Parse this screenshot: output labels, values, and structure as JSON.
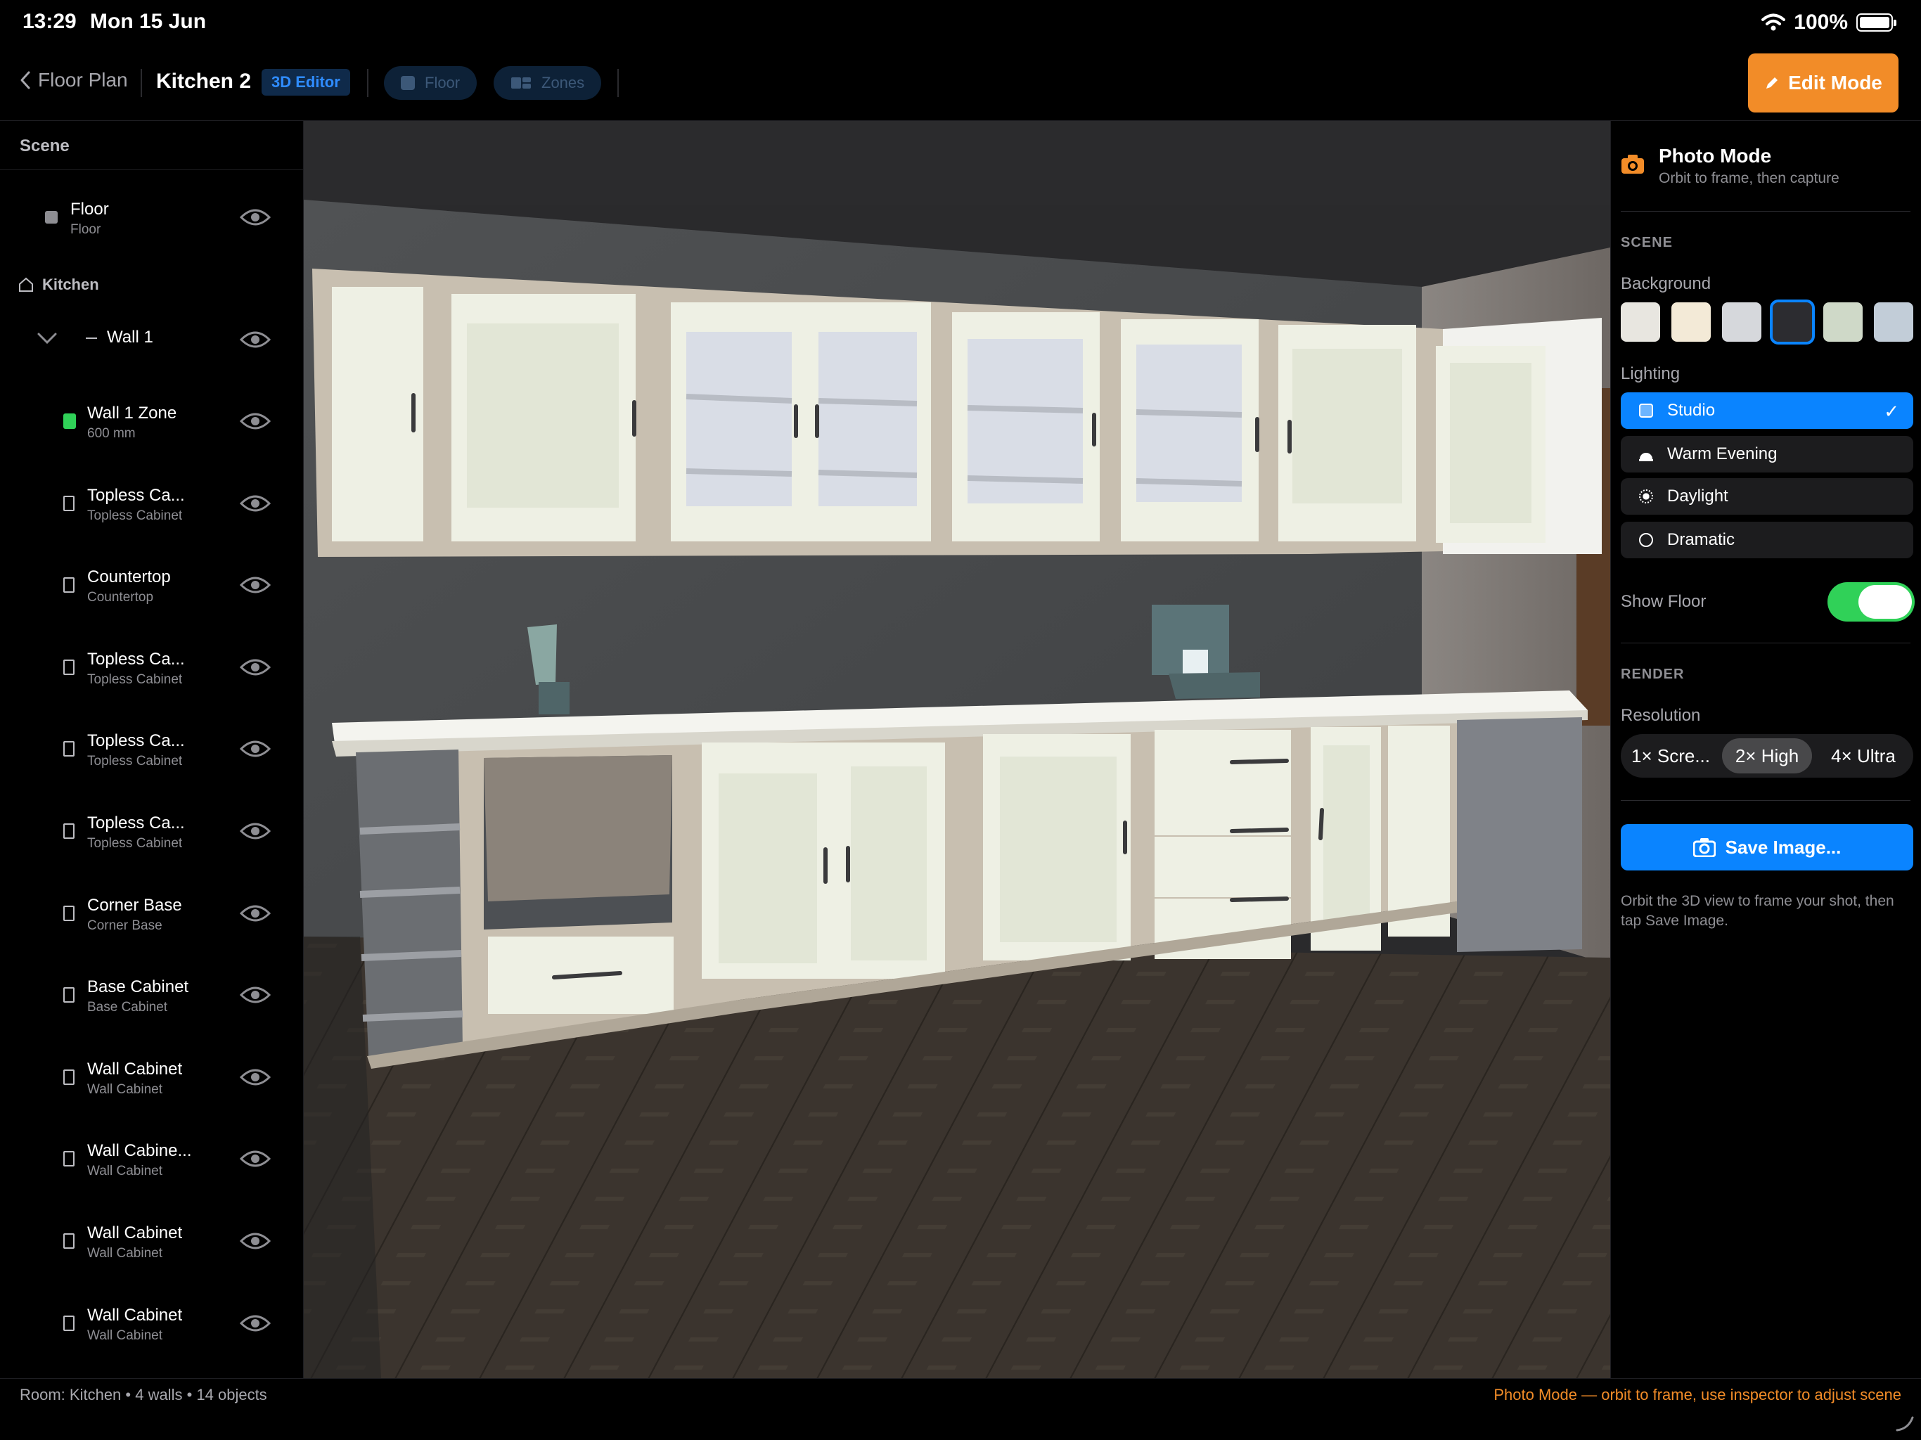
{
  "status_bar": {
    "time": "13:29",
    "date": "Mon 15 Jun",
    "battery": "100%"
  },
  "nav": {
    "back_label": "Floor Plan",
    "title": "Kitchen 2",
    "editor_badge": "3D Editor",
    "floor_label": "Floor",
    "zones_label": "Zones",
    "edit_mode_label": "Edit Mode"
  },
  "sidebar": {
    "header": "Scene",
    "floor": {
      "name": "Floor",
      "sub": "Floor"
    },
    "kitchen_label": "Kitchen",
    "wall": {
      "name": "Wall 1"
    },
    "items": [
      {
        "name": "Wall 1 Zone",
        "sub": "600 mm",
        "icon": "green-square-icon"
      },
      {
        "name": "Topless Ca...",
        "sub": "Topless Cabinet",
        "icon": "cabinet-icon"
      },
      {
        "name": "Countertop",
        "sub": "Countertop",
        "icon": "countertop-icon"
      },
      {
        "name": "Topless Ca...",
        "sub": "Topless Cabinet",
        "icon": "cabinet-icon"
      },
      {
        "name": "Topless Ca...",
        "sub": "Topless Cabinet",
        "icon": "cabinet-icon"
      },
      {
        "name": "Topless Ca...",
        "sub": "Topless Cabinet",
        "icon": "cabinet-icon"
      },
      {
        "name": "Corner Base",
        "sub": "Corner Base",
        "icon": "corner-base-icon"
      },
      {
        "name": "Base Cabinet",
        "sub": "Base Cabinet",
        "icon": "base-cabinet-icon"
      },
      {
        "name": "Wall Cabinet",
        "sub": "Wall Cabinet",
        "icon": "wall-cabinet-icon"
      },
      {
        "name": "Wall Cabine...",
        "sub": "Wall Cabinet",
        "icon": "wall-cabinet-icon"
      },
      {
        "name": "Wall Cabinet",
        "sub": "Wall Cabinet",
        "icon": "wall-cabinet-icon"
      },
      {
        "name": "Wall Cabinet",
        "sub": "Wall Cabinet",
        "icon": "wall-cabinet-icon"
      }
    ]
  },
  "inspector": {
    "title": "Photo Mode",
    "subtitle": "Orbit to frame, then capture",
    "scene_section": "SCENE",
    "background_label": "Background",
    "background_swatches": [
      "#e8e6e0",
      "#f3ead7",
      "#d6d8dc",
      "#2c2c30",
      "#cfd9c8",
      "#c2cdd8"
    ],
    "lighting_label": "Lighting",
    "lighting_options": [
      {
        "label": "Studio",
        "icon": "studio-icon"
      },
      {
        "label": "Warm Evening",
        "icon": "sunset-icon"
      },
      {
        "label": "Daylight",
        "icon": "sun-icon"
      },
      {
        "label": "Dramatic",
        "icon": "circle-icon"
      }
    ],
    "selected_lighting": "Studio",
    "show_floor_label": "Show Floor",
    "show_floor_on": true,
    "render_section": "RENDER",
    "resolution_label": "Resolution",
    "resolution_options": [
      "1× Scre...",
      "2× High",
      "4× Ultra"
    ],
    "selected_resolution": "2× High",
    "save_label": "Save Image...",
    "hint": "Orbit the 3D view to frame your shot, then tap Save Image."
  },
  "bottom_bar": {
    "room_info": "Room: Kitchen  •  4 walls  •  14 objects",
    "mode_hint": "Photo Mode — orbit to frame, use inspector to adjust scene"
  },
  "colors": {
    "accent": "#0a84ff",
    "edit_orange": "#f28c28",
    "toggle_green": "#30d158"
  }
}
